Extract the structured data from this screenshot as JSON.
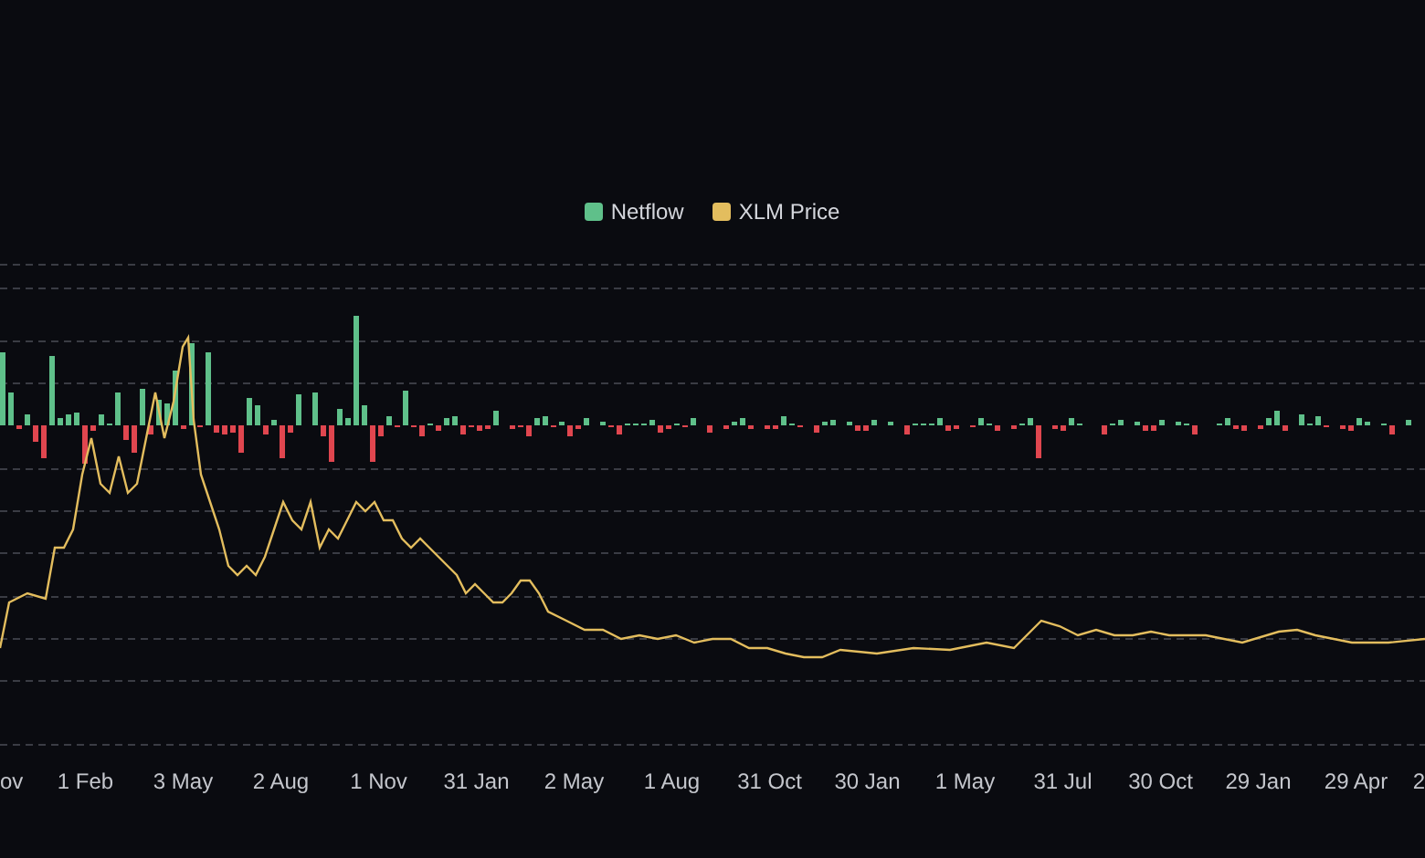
{
  "legend": [
    {
      "label": "Netflow",
      "color": "#5fc08a"
    },
    {
      "label": "XLM Price",
      "color": "#e3bd5e"
    }
  ],
  "x_axis_labels": [
    "ov",
    "1 Feb",
    "3 May",
    "2 Aug",
    "1 Nov",
    "31 Jan",
    "2 May",
    "1 Aug",
    "31 Oct",
    "30 Jan",
    "1 May",
    "31 Jul",
    "30 Oct",
    "29 Jan",
    "29 Apr",
    "2"
  ]
}
